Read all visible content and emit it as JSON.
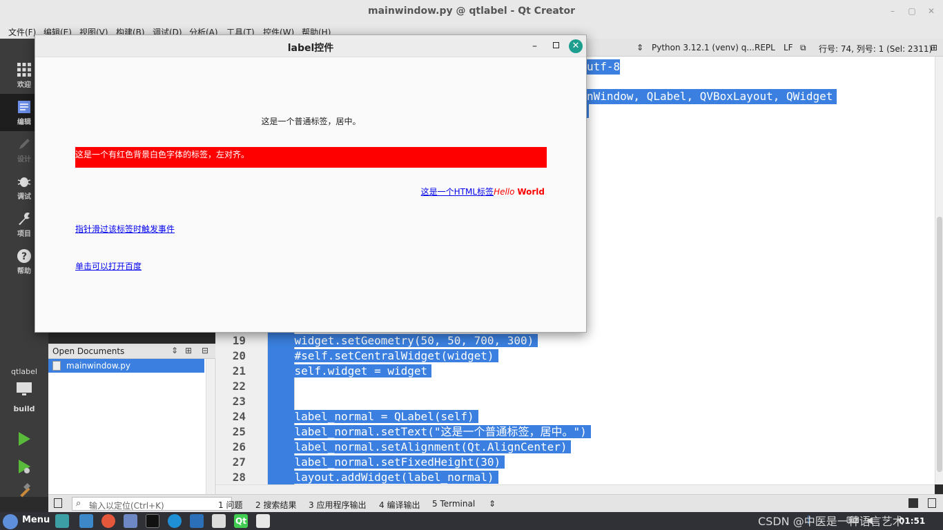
{
  "window": {
    "title": "mainwindow.py @ qtlabel - Qt Creator"
  },
  "menu": [
    "文件(F)",
    "编辑(E)",
    "视图(V)",
    "构建(B)",
    "调试(D)",
    "分析(A)",
    "工具(T)",
    "控件(W)",
    "帮助(H)"
  ],
  "modes": {
    "welcome": "欢迎",
    "edit": "编辑",
    "design": "设计",
    "debug": "调试",
    "projects": "项目",
    "help": "帮助"
  },
  "kit": {
    "project": "qtlabel",
    "config": "build"
  },
  "editor_toolbar": {
    "interpreter": "Python 3.12.1 (venv) q...",
    "repl": "REPL",
    "line_ending": "LF",
    "position": "行号: 74, 列号: 1 (Sel: 2311)"
  },
  "code_top": {
    "line_a": "utf-8",
    "line_b": "nWindow, QLabel, QVBoxLayout, QWidget"
  },
  "code_lines": [
    {
      "no": "19",
      "text": "    widget.setGeometry(50, 50, 700, 300)"
    },
    {
      "no": "20",
      "text": "    #self.setCentralWidget(widget)"
    },
    {
      "no": "21",
      "text": "    self.widget = widget"
    },
    {
      "no": "22",
      "text": ""
    },
    {
      "no": "23",
      "text": ""
    },
    {
      "no": "24",
      "text": "    label_normal = QLabel(self)"
    },
    {
      "no": "25",
      "text": "    label_normal.setText(\"这是一个普通标签，居中。\")"
    },
    {
      "no": "26",
      "text": "    label_normal.setAlignment(Qt.AlignCenter)"
    },
    {
      "no": "27",
      "text": "    label_normal.setFixedHeight(30)"
    },
    {
      "no": "28",
      "text": "    layout.addWidget(label_normal)"
    }
  ],
  "open_documents": {
    "header": "Open Documents",
    "file": "mainwindow.py"
  },
  "output_pane": {
    "locator_placeholder": "输入以定位(Ctrl+K)",
    "tabs": [
      "1  问题",
      "2  搜索结果",
      "3  应用程序输出",
      "4  编译输出",
      "5  Terminal"
    ]
  },
  "dialog": {
    "title": "label控件",
    "label_normal": "这是一个普通标签，居中。",
    "label_red": "这是一个有红色背景白色字体的标签，左对齐。",
    "label_html_link": "这是一个HTML标签",
    "label_html_hello": "Hello",
    "label_html_world": "World",
    "label_hover": "指针滑过该标签时触发事件",
    "label_baidu": "单击可以打开百度"
  },
  "taskbar": {
    "menu": "Menu",
    "watermark": "CSDN @中医是一种语言艺术",
    "clock": "01:51"
  },
  "colors": {
    "selection": "#3b80e0",
    "red_label_bg": "#ff0000",
    "link": "#0000ee"
  }
}
